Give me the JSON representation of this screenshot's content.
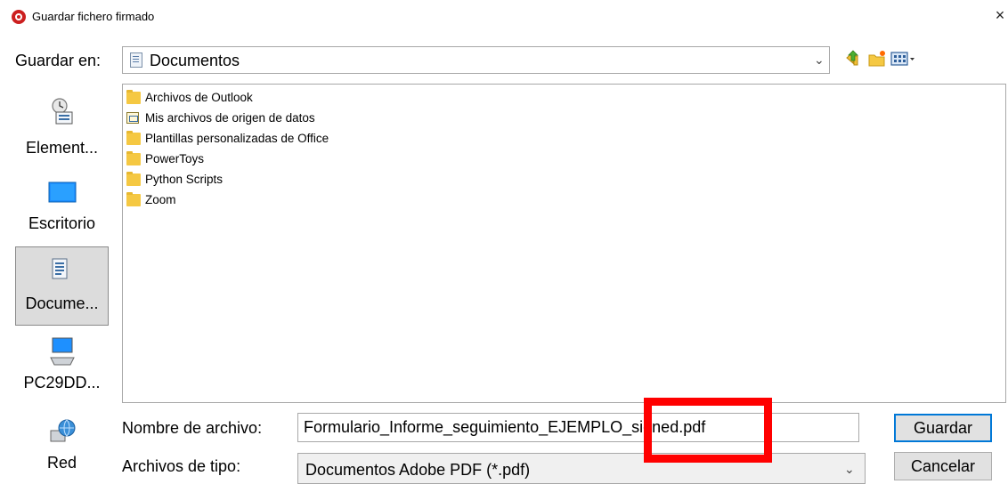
{
  "window": {
    "title": "Guardar fichero firmado",
    "close_glyph": "×"
  },
  "save_in": {
    "label": "Guardar en:",
    "value": "Documentos"
  },
  "places": [
    {
      "label": "Element..."
    },
    {
      "label": "Escritorio"
    },
    {
      "label": "Docume..."
    },
    {
      "label": "PC29DD..."
    },
    {
      "label": "Red"
    }
  ],
  "files": [
    {
      "name": "Archivos de Outlook",
      "icon": "folder-icon"
    },
    {
      "name": "Mis archivos de origen de datos",
      "icon": "data-source-folder-icon"
    },
    {
      "name": "Plantillas personalizadas de Office",
      "icon": "folder-icon"
    },
    {
      "name": "PowerToys",
      "icon": "folder-icon"
    },
    {
      "name": "Python Scripts",
      "icon": "folder-icon"
    },
    {
      "name": "Zoom",
      "icon": "folder-icon"
    }
  ],
  "file_name": {
    "label": "Nombre de archivo:",
    "value": "Formulario_Informe_seguimiento_EJEMPLO_signed.pdf"
  },
  "file_type": {
    "label": "Archivos de tipo:",
    "value": "Documentos Adobe PDF (*.pdf)"
  },
  "buttons": {
    "save": "Guardar",
    "cancel": "Cancelar"
  },
  "colors": {
    "highlight": "#ff0000",
    "accent": "#0078d7",
    "folder": "#f5c842"
  }
}
